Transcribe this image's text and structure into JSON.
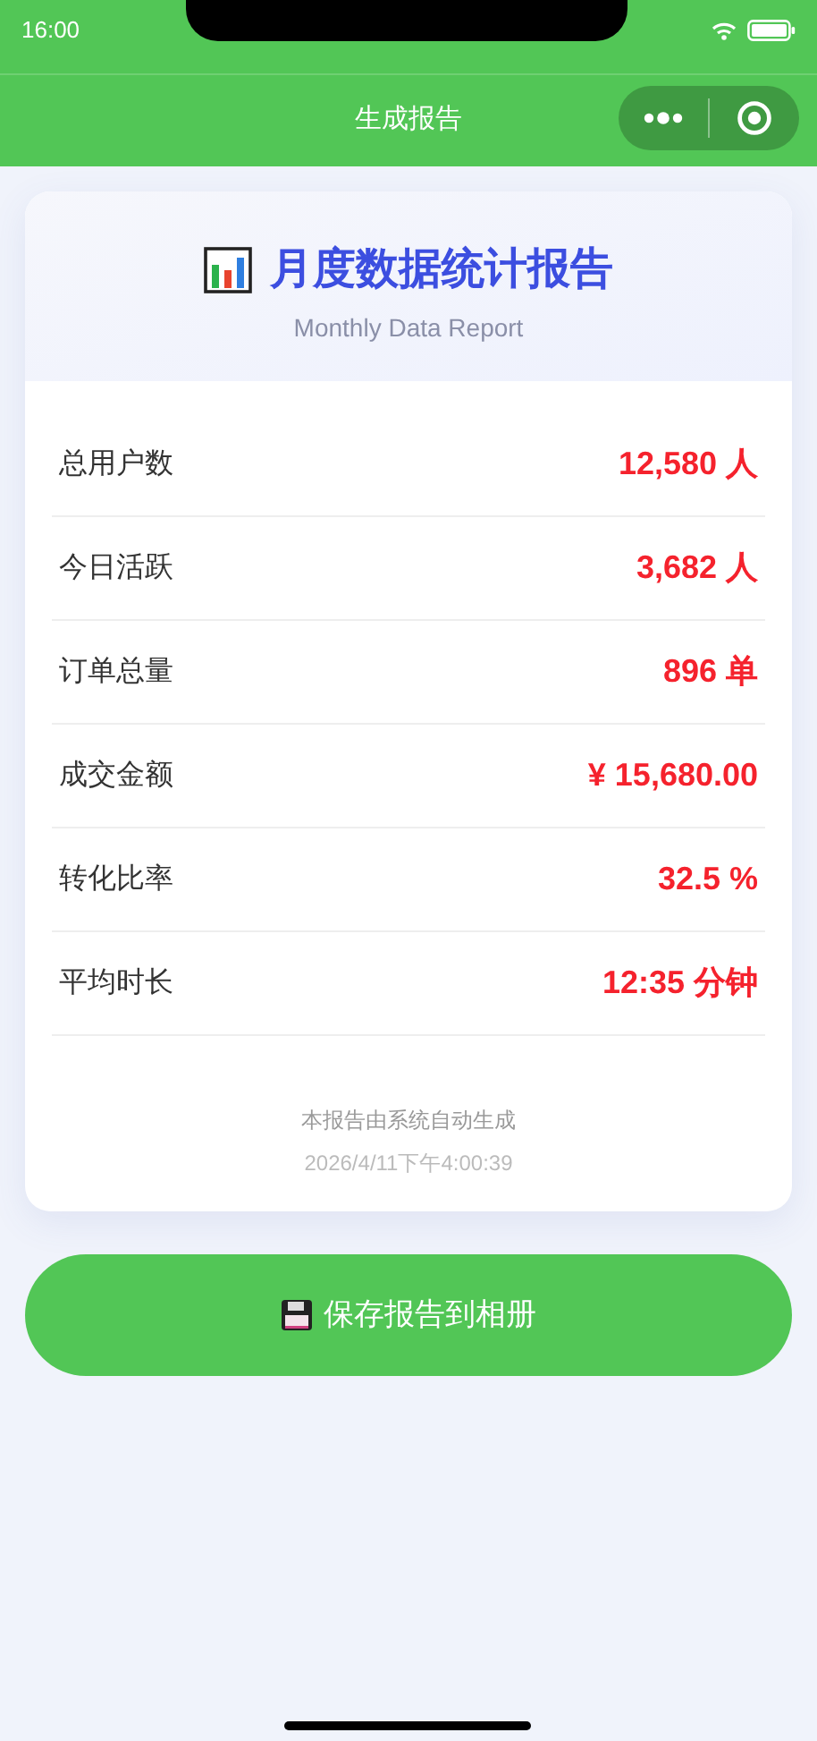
{
  "status_bar": {
    "time": "16:00"
  },
  "nav_bar": {
    "title": "生成报告"
  },
  "report": {
    "title": "月度数据统计报告",
    "subtitle": "Monthly Data Report",
    "rows": [
      {
        "label": "总用户数",
        "value": "12,580 人"
      },
      {
        "label": "今日活跃",
        "value": "3,682 人"
      },
      {
        "label": "订单总量",
        "value": "896 单"
      },
      {
        "label": "成交金额",
        "value": "¥ 15,680.00"
      },
      {
        "label": "转化比率",
        "value": "32.5 %"
      },
      {
        "label": "平均时长",
        "value": "12:35 分钟"
      }
    ],
    "footer_note": "本报告由系统自动生成",
    "timestamp": "2026/4/11下午4:00:39"
  },
  "save_button": {
    "label": "保存报告到相册"
  }
}
